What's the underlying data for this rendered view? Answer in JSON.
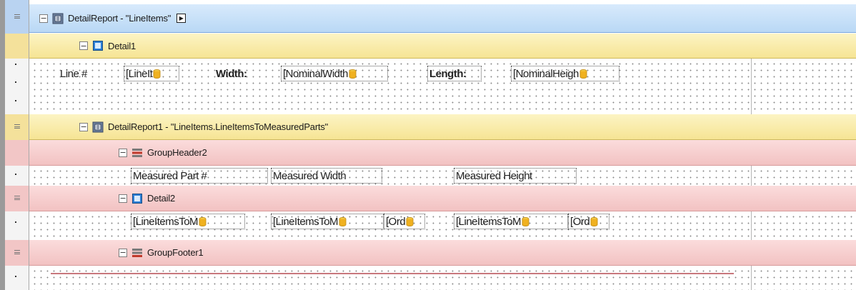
{
  "bands": {
    "detail_report": {
      "caption": "DetailReport - \"LineItems\"",
      "color": "#c8e0f8"
    },
    "detail1": {
      "caption": "Detail1",
      "color": "#f8ecb0"
    },
    "detail_report1": {
      "caption": "DetailReport1 - \"LineItems.LineItemsToMeasuredParts\"",
      "color": "#f8ecb0"
    },
    "group_header2": {
      "caption": "GroupHeader2",
      "color": "#f6cfcf"
    },
    "detail2": {
      "caption": "Detail2",
      "color": "#f6cfcf"
    },
    "group_footer1": {
      "caption": "GroupFooter1",
      "color": "#f6cfcf"
    }
  },
  "detail1_fields": {
    "line_label": "Line #",
    "line_value": "[LineIt",
    "width_label": "Width:",
    "width_value": "[NominalWidth",
    "length_label": "Length:",
    "length_value": "[NominalHeigh"
  },
  "group_header2_fields": {
    "col1": "Measured Part #",
    "col2": "Measured Width",
    "col3": "Measured Height"
  },
  "detail2_fields": {
    "part_value": "[LineItemsToM",
    "width_value": "[LineItemsToM",
    "width_order": "[Ord",
    "height_value": "[LineItemsToM",
    "height_order": "[Ord"
  },
  "icons": {
    "collapse": "minus-box-icon",
    "report": "detail-report-icon",
    "detail": "detail-band-icon",
    "group": "group-band-icon",
    "database": "database-icon",
    "smart_tag": "smart-tag-icon"
  },
  "collapse_glyph": "−",
  "smart_tag_glyph": "▶"
}
